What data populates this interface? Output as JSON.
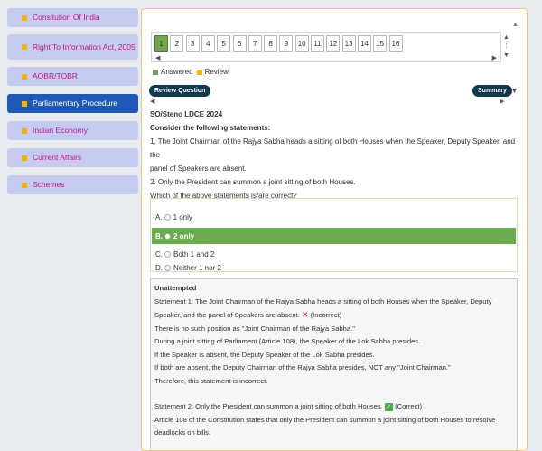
{
  "sidebar": {
    "items": [
      {
        "label": "Consitution Of India"
      },
      {
        "label": "Right To Information Act, 2005"
      },
      {
        "label": "AOBR/TOBR"
      },
      {
        "label": "Parliamentary Procedure"
      },
      {
        "label": "Indian Economy"
      },
      {
        "label": "Current Affairs"
      },
      {
        "label": "Schemes"
      }
    ],
    "active_index": 3
  },
  "palette": {
    "questions": [
      "1",
      "2",
      "3",
      "4",
      "5",
      "6",
      "7",
      "8",
      "9",
      "10",
      "11",
      "12",
      "13",
      "14",
      "15",
      "16"
    ],
    "answered_index": 0
  },
  "legend": {
    "answered": "Answered",
    "review": "Review",
    "answered_color": "#6ea74e",
    "review_color": "#f0b400"
  },
  "buttons": {
    "review_question": "Review Question",
    "summary": "Summary"
  },
  "question": {
    "exam": "SO/Steno LDCE 2024",
    "prompt": "Consider the following statements:",
    "line1": "1. The Joint Chairman of the Rajya Sabha heads a sitting of both Houses when the Speaker, Deputy Speaker, and the",
    "line1b": "panel of Speakers are absent.",
    "line2": "2. Only the President can summon a joint sitting of both Houses.",
    "ask": "Which of the above statements is/are correct?"
  },
  "options": [
    {
      "key": "A.",
      "text": "1 only"
    },
    {
      "key": "B.",
      "text": "2 only"
    },
    {
      "key": "C.",
      "text": "Both 1 and 2"
    },
    {
      "key": "D.",
      "text": "Neither 1 nor 2"
    }
  ],
  "correct_index": 1,
  "explanation": {
    "status": "Unattempted",
    "s1a": "Statement 1: The Joint Chairman of the Rajya Sabha heads a sitting of both Houses when the Speaker, Deputy",
    "s1b": "Speaker, and the panel of Speakers are absent.",
    "s1tag": "(Incorrect)",
    "p1": "There is no such position as \"Joint Chairman of the Rajya Sabha.\"",
    "p2": "During a joint sitting of Parliament (Article 108), the Speaker of the Lok Sabha presides.",
    "p3": "If the Speaker is absent, the Deputy Speaker of the Lok Sabha presides.",
    "p4": "If both are absent, the Deputy Chairman of the Rajya Sabha presides, NOT any \"Joint Chairman.\"",
    "p5": "Therefore, this statement is incorrect.",
    "s2": "Statement 2: Only the President can summon a joint sitting of both Houses.",
    "s2tag": "(Correct)",
    "p6": "Article 108 of the Constitution states that only the President can summon a joint sitting of both Houses to resolve",
    "p7": "deadlocks on bills."
  }
}
